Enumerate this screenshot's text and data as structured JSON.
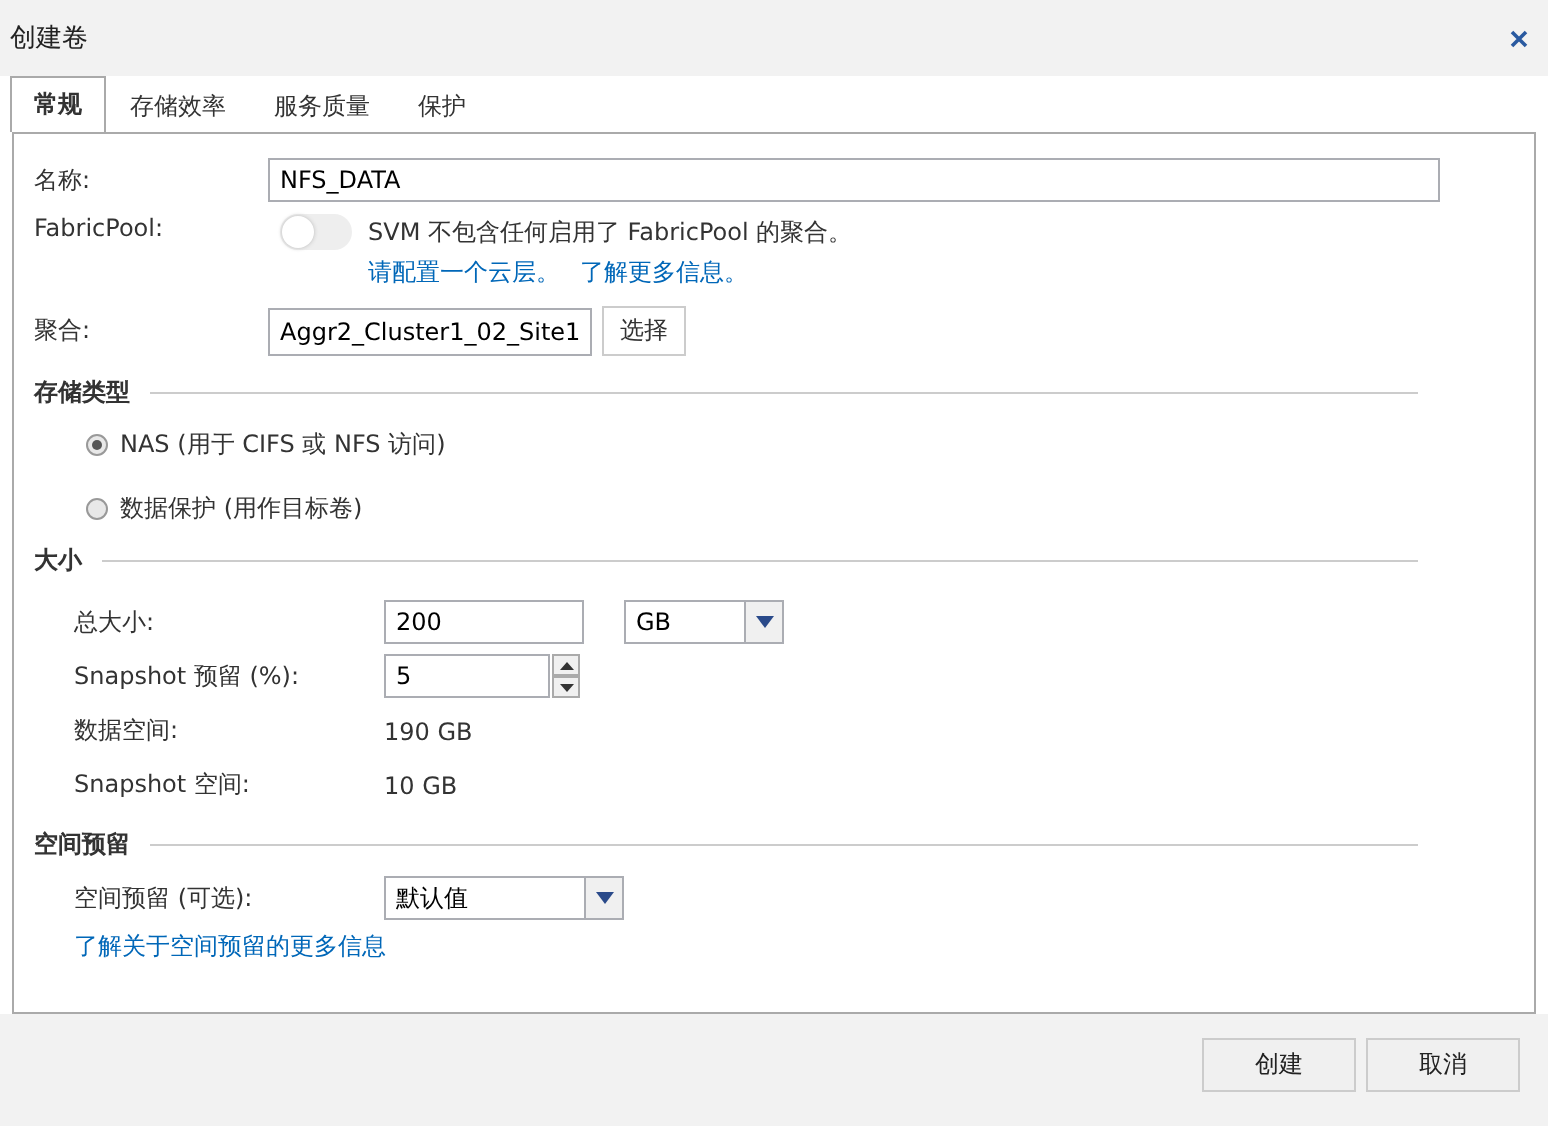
{
  "window": {
    "title": "创建卷"
  },
  "tabs": [
    {
      "label": "常规",
      "selected": true
    },
    {
      "label": "存储效率",
      "selected": false
    },
    {
      "label": "服务质量",
      "selected": false
    },
    {
      "label": "保护",
      "selected": false
    }
  ],
  "general": {
    "name": {
      "label": "名称:",
      "value": "NFS_DATA"
    },
    "fabricpool": {
      "label": "FabricPool:",
      "on": false,
      "message": "SVM 不包含任何启用了 FabricPool 的聚合。",
      "links": [
        "请配置一个云层。",
        "了解更多信息。"
      ]
    },
    "aggregate": {
      "label": "聚合:",
      "value": "Aggr2_Cluster1_02_Site1",
      "button": "选择"
    }
  },
  "storage_type": {
    "title": "存储类型",
    "options": [
      {
        "label": "NAS (用于 CIFS 或 NFS 访问)",
        "selected": true
      },
      {
        "label": "数据保护 (用作目标卷)",
        "selected": false
      }
    ]
  },
  "size": {
    "title": "大小",
    "total": {
      "label": "总大小:",
      "value": "200",
      "unit": "GB"
    },
    "snapshot_reserve": {
      "label": "Snapshot 预留 (%):",
      "value": "5"
    },
    "data_space": {
      "label": "数据空间:",
      "value": "190 GB"
    },
    "snapshot_space": {
      "label": "Snapshot 空间:",
      "value": "10 GB"
    }
  },
  "space_reservation": {
    "title": "空间预留",
    "label": "空间预留 (可选):",
    "value": "默认值",
    "link": "了解关于空间预留的更多信息"
  },
  "buttons": [
    "创建",
    "取消"
  ]
}
